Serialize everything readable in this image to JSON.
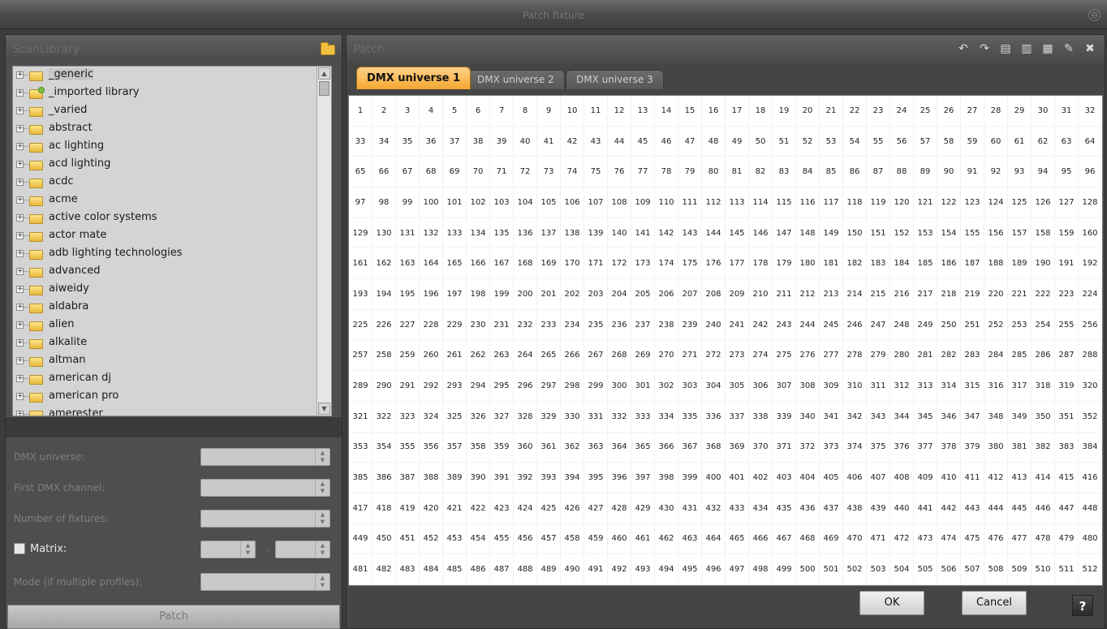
{
  "window": {
    "title": "Patch fixture",
    "close_glyph": "⊖"
  },
  "library": {
    "title": "ScanLibrary",
    "icon": "folder-open-icon",
    "items": [
      {
        "label": "_generic",
        "selected": true
      },
      {
        "label": "_imported library",
        "special": true
      },
      {
        "label": "_varied"
      },
      {
        "label": "abstract"
      },
      {
        "label": "ac lighting"
      },
      {
        "label": "acd lighting"
      },
      {
        "label": "acdc"
      },
      {
        "label": "acme"
      },
      {
        "label": "active color systems"
      },
      {
        "label": "actor mate"
      },
      {
        "label": "adb lighting technologies"
      },
      {
        "label": "advanced"
      },
      {
        "label": "aiweidy"
      },
      {
        "label": "aldabra"
      },
      {
        "label": "alien"
      },
      {
        "label": "alkalite"
      },
      {
        "label": "altman"
      },
      {
        "label": "american dj"
      },
      {
        "label": "american pro"
      },
      {
        "label": "amerester"
      }
    ]
  },
  "form": {
    "dmx_universe_label": "DMX universe:",
    "first_channel_label": "First DMX channel:",
    "num_fixtures_label": "Number of fixtures:",
    "matrix_label": "Matrix:",
    "matrix_x": "x",
    "mode_label": "Mode (if multiple profiles):",
    "patch_button": "Patch"
  },
  "patch": {
    "title": "Patch",
    "toolbar": [
      "undo-icon",
      "redo-icon",
      "copy-icon",
      "paste-icon",
      "move-icon",
      "edit-icon",
      "delete-icon"
    ],
    "tabs": [
      "DMX universe 1",
      "DMX universe 2",
      "DMX universe 3"
    ],
    "active_tab": 0,
    "channels": 512,
    "ok_button": "OK",
    "cancel_button": "Cancel",
    "help": "?"
  }
}
